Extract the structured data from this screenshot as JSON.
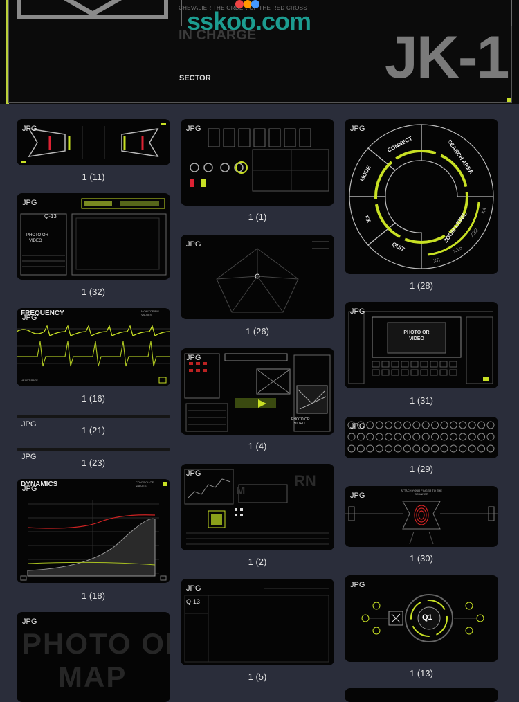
{
  "banner": {
    "subtitle": "CHEVALIER    THE ORDER OF THE RED CROSS",
    "in_charge": "IN CHARGE",
    "sector": "SECTOR",
    "code": "JK-1",
    "watermark": "sskoo.com"
  },
  "file_tag": "JPG",
  "cards": [
    {
      "caption": "1 (11)",
      "thumb": "top-down vehicle hud"
    },
    {
      "caption": "1 (32)",
      "thumb": "q-13 photo or video panel"
    },
    {
      "caption": "1 (16)",
      "thumb": "frequency heart rate",
      "title": "FREQUENCY",
      "label_tr": "MONITORING VALUES",
      "label_bl": "HEART RATE"
    },
    {
      "caption": "1 (21)",
      "thumb": "thin strip"
    },
    {
      "caption": "1 (23)",
      "thumb": "thin strip"
    },
    {
      "caption": "1 (18)",
      "thumb": "dynamics chart",
      "title": "DYNAMICS",
      "label_tr": "CONTROL OF VALUES"
    },
    {
      "caption": "",
      "thumb": "photo or map",
      "big_text": "PHOTO OR",
      "big_text2": "MAP"
    },
    {
      "caption": "1 (1)",
      "thumb": "gauges panel"
    },
    {
      "caption": "1 (26)",
      "thumb": "target radar"
    },
    {
      "caption": "1 (4)",
      "thumb": "multi panel dashboard",
      "inner_text": "PHOTO OR VIDEO"
    },
    {
      "caption": "1 (2)",
      "thumb": "data dashboard"
    },
    {
      "caption": "1 (5)",
      "thumb": "q-13 empty panel",
      "inner_text": "Q-13"
    },
    {
      "caption": "1 (28)",
      "thumb": "radial menu"
    },
    {
      "caption": "1 (31)",
      "thumb": "photo or video keyboard",
      "inner_text": "PHOTO OR VIDEO"
    },
    {
      "caption": "1 (29)",
      "thumb": "circle button grid"
    },
    {
      "caption": "1 (30)",
      "thumb": "fingerprint scanner",
      "inner_text": "ATTACH YOUR FINGER TO THE SCANNER"
    },
    {
      "caption": "1 (13)",
      "thumb": "q1 circular hud",
      "inner_text": "Q1"
    }
  ],
  "radial_menu": {
    "items": [
      "CONNECT",
      "SEARCH AREA",
      "MODE",
      "FX",
      "QUIT",
      "ZOOM LEVEL",
      "X4",
      "X32",
      "X16",
      "X8"
    ]
  },
  "colors": {
    "accent": "#c8e024",
    "background": "#2a2d3a",
    "card": "#050505",
    "banner": "#0b0b0b"
  }
}
